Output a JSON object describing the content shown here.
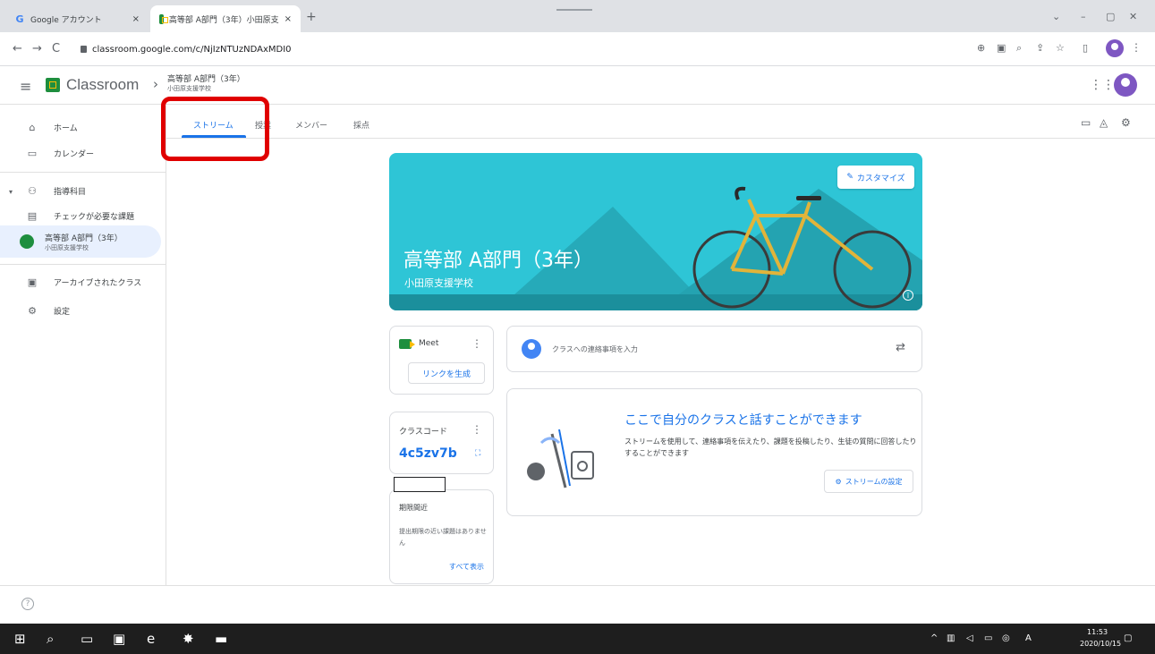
{
  "browser": {
    "tabs": [
      {
        "title": "Google アカウント",
        "close": "×"
      },
      {
        "title": "高等部 A部門（3年）小田原支",
        "close": "×"
      }
    ],
    "new_tab": "+",
    "url": "classroom.google.com/c/NjIzNTUzNDAxMDI0",
    "back": "←",
    "forward": "→",
    "reload": "C"
  },
  "header": {
    "app_title": "Classroom",
    "breadcrumb_chevron": "›",
    "class_name": "高等部 A部門（3年）",
    "class_school": "小田原支援学校"
  },
  "sidebar": {
    "home": "ホーム",
    "calendar": "カレンダー",
    "teaching": "指導科目",
    "todo": "チェックが必要な課題",
    "active_class": {
      "name": "高等部 A部門（3年）",
      "school": "小田原支援学校"
    },
    "archived": "アーカイブされたクラス",
    "settings": "設定"
  },
  "tabs": {
    "stream": "ストリーム",
    "classwork": "授業",
    "people": "メンバー",
    "grades": "採点"
  },
  "banner": {
    "title": "高等部 A部門（3年）",
    "subtitle": "小田原支援学校",
    "customize": "カスタマイズ",
    "info": "i"
  },
  "meet": {
    "label": "Meet",
    "generate_link": "リンクを生成"
  },
  "class_code": {
    "label": "クラスコード",
    "value": "4c5zv7b"
  },
  "upcoming": {
    "label": "期限間近",
    "text": "提出期限の近い課題はありません",
    "see_all": "すべて表示"
  },
  "announce": {
    "placeholder": "クラスへの連絡事項を入力"
  },
  "talk": {
    "title": "ここで自分のクラスと話すことができます",
    "desc": "ストリームを使用して、連絡事項を伝えたり、課題を投稿したり、生徒の質問に回答したりすることができます",
    "stream_settings": "ストリームの設定"
  },
  "taskbar": {
    "time": "11:53",
    "date": "2020/10/15"
  },
  "colors": {
    "accent": "#1a73e8",
    "banner": "#2ec5d6",
    "highlight": "#e00000"
  }
}
